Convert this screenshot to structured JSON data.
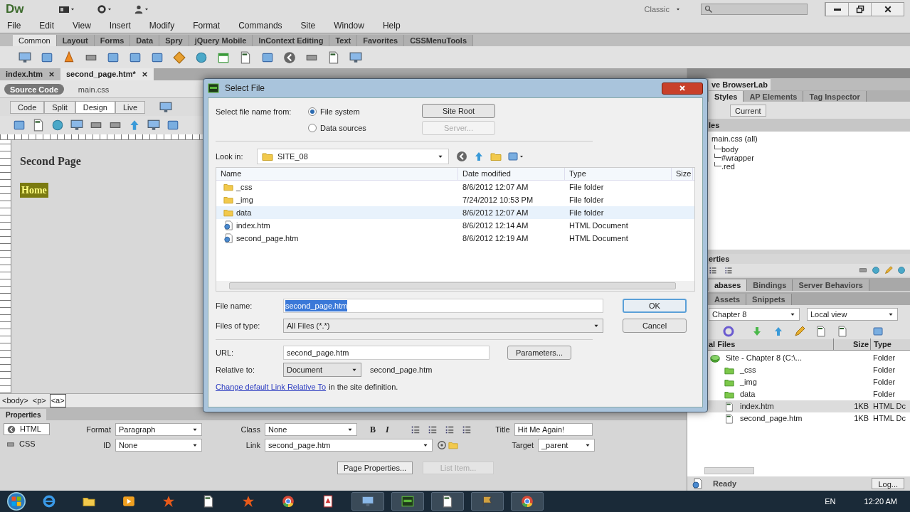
{
  "app": {
    "logo": "Dw",
    "workspace": "Classic"
  },
  "menu": [
    "File",
    "Edit",
    "View",
    "Insert",
    "Modify",
    "Format",
    "Commands",
    "Site",
    "Window",
    "Help"
  ],
  "insert_tabs": [
    {
      "label": "Common",
      "selected": true
    },
    {
      "label": "Layout",
      "selected": false
    },
    {
      "label": "Forms",
      "selected": false
    },
    {
      "label": "Data",
      "selected": false
    },
    {
      "label": "Spry",
      "selected": false
    },
    {
      "label": "jQuery Mobile",
      "selected": false
    },
    {
      "label": "InContext Editing",
      "selected": false
    },
    {
      "label": "Text",
      "selected": false
    },
    {
      "label": "Favorites",
      "selected": false
    },
    {
      "label": "CSSMenuTools",
      "selected": false
    }
  ],
  "doc_tabs": [
    {
      "label": "index.htm",
      "selected": false
    },
    {
      "label": "second_page.htm*",
      "selected": true
    }
  ],
  "related_files": [
    {
      "label": "Source Code",
      "selected": true
    },
    {
      "label": "main.css",
      "selected": false
    }
  ],
  "view_buttons": [
    {
      "label": "Code",
      "selected": false
    },
    {
      "label": "Split",
      "selected": false
    },
    {
      "label": "Design",
      "selected": true
    },
    {
      "label": "Live",
      "selected": false
    }
  ],
  "document": {
    "heading": "Second Page",
    "link": "Home"
  },
  "tag_selector": [
    {
      "label": "<body>",
      "selected": false
    },
    {
      "label": "<p>",
      "selected": false
    },
    {
      "label": "<a>",
      "selected": true
    }
  ],
  "properties": {
    "title": "Properties",
    "modes": [
      {
        "label": "HTML",
        "selected": true
      },
      {
        "label": "CSS",
        "selected": false
      }
    ],
    "format": {
      "label": "Format",
      "value": "Paragraph"
    },
    "id": {
      "label": "ID",
      "value": "None"
    },
    "class": {
      "label": "Class",
      "value": "None"
    },
    "link": {
      "label": "Link",
      "value": "second_page.htm"
    },
    "bold": "B",
    "italic": "I",
    "title_field": {
      "label": "Title",
      "value": "Hit Me Again!"
    },
    "target": {
      "label": "Target",
      "value": "_parent"
    },
    "buttons": [
      {
        "label": "Page Properties...",
        "disabled": false
      },
      {
        "label": "List Item...",
        "disabled": true
      }
    ]
  },
  "right_panel": {
    "top_tab": "ve BrowserLab",
    "css_tabs": [
      {
        "label": "Styles",
        "selected": true
      },
      {
        "label": "AP Elements",
        "selected": false
      },
      {
        "label": "Tag Inspector",
        "selected": false
      }
    ],
    "current_button": "Current",
    "rules_header": "les",
    "rules": {
      "label": "main.css (all)",
      "children": [
        {
          "label": "body"
        },
        {
          "label": "#wrapper"
        },
        {
          "label": ".red"
        }
      ]
    },
    "properties_header": "erties",
    "db_tabs": [
      {
        "label": "abases",
        "selected": true
      },
      {
        "label": "Bindings",
        "selected": false
      },
      {
        "label": "Server Behaviors",
        "selected": false
      }
    ],
    "files_tabs": [
      {
        "label": "Assets",
        "selected": false
      },
      {
        "label": "Snippets",
        "selected": false
      }
    ],
    "site_select": "Chapter 8",
    "view_select": "Local view",
    "file_columns": [
      "al Files",
      "Size",
      "Type"
    ],
    "files": [
      {
        "name": "Site - Chapter 8 (C:\\...",
        "type": "Folder",
        "kind": "site",
        "selected": false,
        "children": [
          {
            "name": "_css",
            "type": "Folder",
            "kind": "folder",
            "selected": false
          },
          {
            "name": "_img",
            "type": "Folder",
            "kind": "folder",
            "selected": false
          },
          {
            "name": "data",
            "type": "Folder",
            "kind": "folder",
            "selected": false
          },
          {
            "name": "index.htm",
            "size": "1KB",
            "type": "HTML Dc",
            "kind": "file",
            "selected": true
          },
          {
            "name": "second_page.htm",
            "size": "1KB",
            "type": "HTML Dc",
            "kind": "file",
            "selected": false
          }
        ]
      }
    ],
    "status": "Ready",
    "log_button": "Log..."
  },
  "dialog": {
    "title": "Select File",
    "source_label": "Select file name from:",
    "sources": [
      {
        "label": "File system",
        "selected": true
      },
      {
        "label": "Data sources",
        "selected": false
      }
    ],
    "buttons": [
      {
        "label": "Site Root",
        "disabled": false
      },
      {
        "label": "Server...",
        "disabled": true
      }
    ],
    "look_in_label": "Look in:",
    "look_in": "SITE_08",
    "columns": [
      "Name",
      "Date modified",
      "Type",
      "Size"
    ],
    "rows": [
      {
        "name": "_css",
        "date": "8/6/2012 12:07 AM",
        "type": "File folder",
        "kind": "folder",
        "hovered": false
      },
      {
        "name": "_img",
        "date": "7/24/2012 10:53 PM",
        "type": "File folder",
        "kind": "folder",
        "hovered": false
      },
      {
        "name": "data",
        "date": "8/6/2012 12:07 AM",
        "type": "File folder",
        "kind": "folder",
        "hovered": true
      },
      {
        "name": "index.htm",
        "date": "8/6/2012 12:14 AM",
        "type": "HTML Document",
        "kind": "file",
        "hovered": false
      },
      {
        "name": "second_page.htm",
        "date": "8/6/2012 12:19 AM",
        "type": "HTML Document",
        "kind": "file",
        "hovered": false
      }
    ],
    "file_name_label": "File name:",
    "file_name": "second_page.htm",
    "file_type_label": "Files of type:",
    "file_type": "All Files (*.*)",
    "ok": "OK",
    "cancel": "Cancel",
    "url_label": "URL:",
    "url": "second_page.htm",
    "parameters": "Parameters...",
    "relative_label": "Relative to:",
    "relative": "Document",
    "relative_path": "second_page.htm",
    "link": "Change default Link Relative To",
    "link_suffix": "in the site definition."
  },
  "taskbar": {
    "language": "EN",
    "time": "12:20 AM"
  }
}
